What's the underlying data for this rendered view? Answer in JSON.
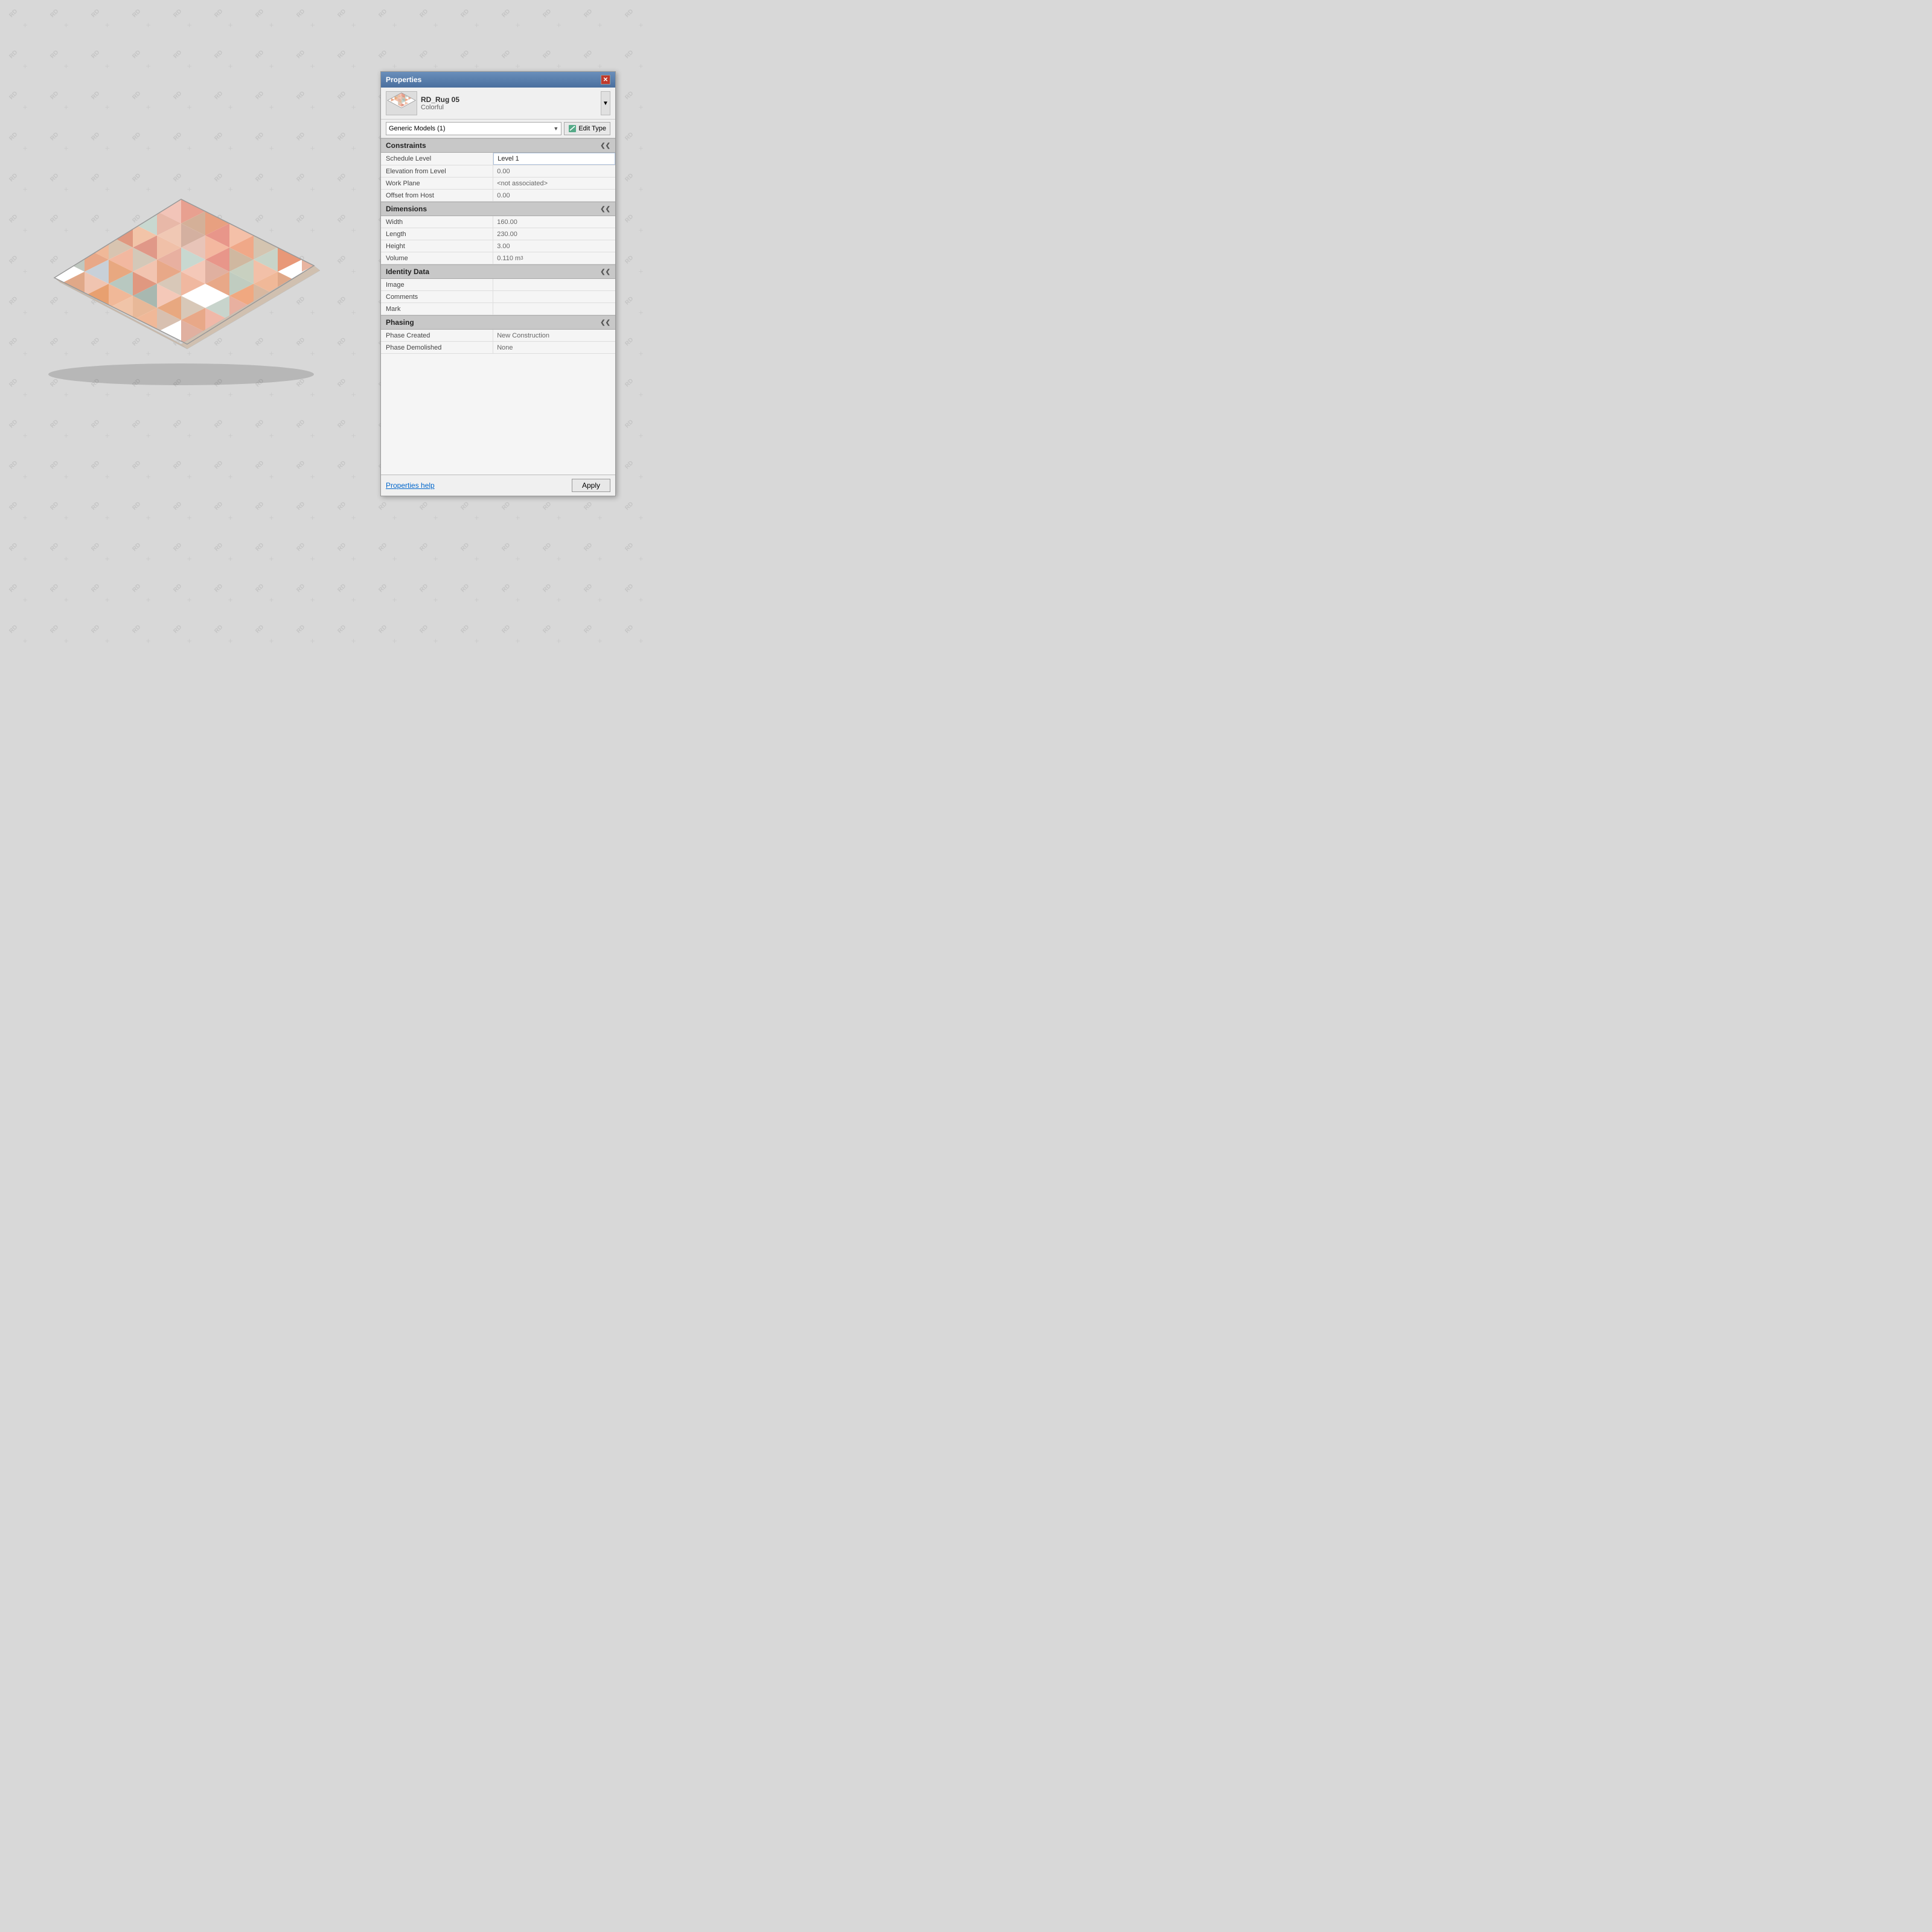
{
  "watermark": {
    "text": "RD",
    "cross": "✕"
  },
  "rug": {
    "alt": "RD_Rug 05 Colorful isometric view"
  },
  "panel": {
    "title": "Properties",
    "close_label": "✕",
    "type_name": "RD_Rug 05",
    "type_category": "Colorful",
    "dropdown_value": "Generic Models (1)",
    "dropdown_arrow": "▼",
    "edit_type_label": "Edit Type",
    "collapse_icon": "❮❮",
    "sections": [
      {
        "id": "constraints",
        "label": "Constraints",
        "rows": [
          {
            "label": "Schedule Level",
            "value": "Level 1",
            "editable": true
          },
          {
            "label": "Elevation from Level",
            "value": "0.00",
            "editable": false
          },
          {
            "label": "Work Plane",
            "value": "<not associated>",
            "editable": false
          },
          {
            "label": "Offset from Host",
            "value": "0.00",
            "editable": false
          }
        ]
      },
      {
        "id": "dimensions",
        "label": "Dimensions",
        "rows": [
          {
            "label": "Width",
            "value": "160.00",
            "editable": false
          },
          {
            "label": "Length",
            "value": "230.00",
            "editable": false
          },
          {
            "label": "Height",
            "value": "3.00",
            "editable": false
          },
          {
            "label": "Volume",
            "value": "0.110 m³",
            "editable": false,
            "superscript": true
          }
        ]
      },
      {
        "id": "identity-data",
        "label": "Identity Data",
        "rows": [
          {
            "label": "Image",
            "value": "",
            "editable": false
          },
          {
            "label": "Comments",
            "value": "",
            "editable": false
          },
          {
            "label": "Mark",
            "value": "",
            "editable": false
          }
        ]
      },
      {
        "id": "phasing",
        "label": "Phasing",
        "rows": [
          {
            "label": "Phase Created",
            "value": "New Construction",
            "editable": false
          },
          {
            "label": "Phase Demolished",
            "value": "None",
            "editable": false
          }
        ]
      }
    ],
    "footer": {
      "help_label": "Properties help",
      "apply_label": "Apply"
    }
  }
}
